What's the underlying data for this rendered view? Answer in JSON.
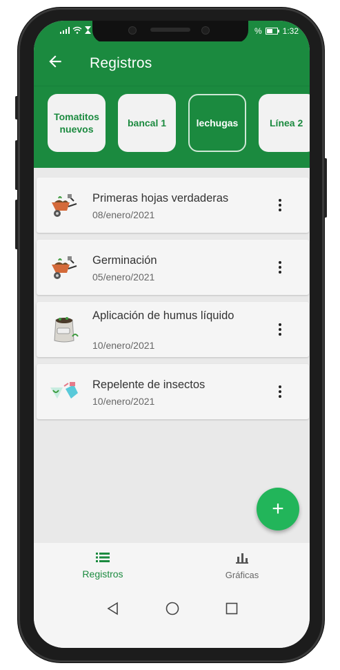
{
  "status_bar": {
    "time": "1:32",
    "battery": "%"
  },
  "app_bar": {
    "title": "Registros",
    "back_icon": "arrow-left-icon"
  },
  "colors": {
    "primary": "#1b8a3f",
    "fab": "#22b55a",
    "chip_bg": "#f2f2f2"
  },
  "chips": [
    {
      "label": "Tomatitos nuevos",
      "selected": false
    },
    {
      "label": "bancal 1",
      "selected": false
    },
    {
      "label": "lechugas",
      "selected": true
    },
    {
      "label": "Línea 2",
      "selected": false
    }
  ],
  "records": [
    {
      "title": "Primeras hojas verdaderas",
      "date": "08/enero/2021",
      "icon": "wheelbarrow-icon"
    },
    {
      "title": "Germinación",
      "date": "05/enero/2021",
      "icon": "wheelbarrow-icon"
    },
    {
      "title": "Aplicación de humus líquido",
      "date": "10/enero/2021",
      "icon": "fertilizer-bag-icon"
    },
    {
      "title": "Repelente de insectos",
      "date": "10/enero/2021",
      "icon": "spray-bottle-icon"
    }
  ],
  "fab": {
    "label": "+",
    "icon": "plus-icon"
  },
  "bottom_nav": [
    {
      "label": "Registros",
      "icon": "list-icon",
      "active": true
    },
    {
      "label": "Gráficas",
      "icon": "bar-chart-icon",
      "active": false
    }
  ],
  "system_nav": [
    "back-triangle-icon",
    "home-circle-icon",
    "recents-square-icon"
  ]
}
